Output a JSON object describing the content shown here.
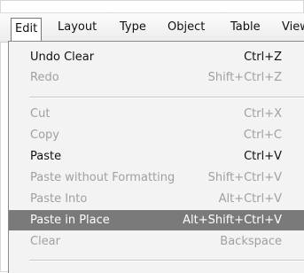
{
  "menubar": {
    "items": [
      "Edit",
      "Layout",
      "Type",
      "Object",
      "Table",
      "View"
    ]
  },
  "edit_menu": {
    "items": [
      {
        "label": "Undo Clear",
        "shortcut": "Ctrl+Z",
        "enabled": true
      },
      {
        "label": "Redo",
        "shortcut": "Shift+Ctrl+Z",
        "enabled": false
      },
      {
        "label": "Cut",
        "shortcut": "Ctrl+X",
        "enabled": false
      },
      {
        "label": "Copy",
        "shortcut": "Ctrl+C",
        "enabled": false
      },
      {
        "label": "Paste",
        "shortcut": "Ctrl+V",
        "enabled": true
      },
      {
        "label": "Paste without Formatting",
        "shortcut": "Shift+Ctrl+V",
        "enabled": false
      },
      {
        "label": "Paste Into",
        "shortcut": "Alt+Ctrl+V",
        "enabled": false
      },
      {
        "label": "Paste in Place",
        "shortcut": "Alt+Shift+Ctrl+V",
        "enabled": true,
        "highlighted": true
      },
      {
        "label": "Clear",
        "shortcut": "Backspace",
        "enabled": false
      }
    ]
  },
  "colors": {
    "highlight": "#7a7a7a",
    "disabled_text": "#a0a0a0",
    "menu_background": "#f3f3f3"
  }
}
